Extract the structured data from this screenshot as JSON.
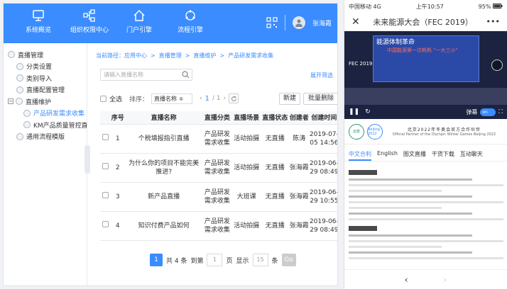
{
  "topnav": {
    "items": [
      {
        "label": "系统概览"
      },
      {
        "label": "组织权限中心"
      },
      {
        "label": "门户引擎"
      },
      {
        "label": "流程引擎"
      }
    ],
    "user": "张海霞"
  },
  "sidebar": {
    "items": [
      {
        "label": "直播管理"
      },
      {
        "label": "分类设置"
      },
      {
        "label": "类别导入"
      },
      {
        "label": "直播配置管理"
      },
      {
        "label": "直播维护"
      },
      {
        "label": "产品研发需求收集"
      },
      {
        "label": "KM产品质量管控直播"
      },
      {
        "label": "通用流程模版"
      }
    ]
  },
  "breadcrumb": {
    "label": "当前路径：",
    "items": [
      "应用中心",
      "直播管理",
      "直播维护",
      "产品研发需求收集"
    ]
  },
  "search": {
    "placeholder": "请输入直播名称",
    "advanced": "展开筛选"
  },
  "toolbar": {
    "select_all": "全选",
    "sort_label": "排序：",
    "sort_value": "直播名称 ≑",
    "page_current": "1",
    "page_total": "/ 1",
    "new_btn": "新建",
    "batch_delete": "批量删除"
  },
  "table": {
    "headers": [
      "序号",
      "直播名称",
      "直播分类",
      "直播场景",
      "直播状态",
      "创建者",
      "创建时间"
    ],
    "rows": [
      {
        "no": "1",
        "name": "个税填报指引直播",
        "category": "产品研发需求收集",
        "scene": "活动拍摄",
        "status": "无直播",
        "creator": "陈涛",
        "time": "2019-07-05 14:56"
      },
      {
        "no": "2",
        "name": "为什么你的项目不能完美推进?",
        "category": "产品研发需求收集",
        "scene": "活动拍摄",
        "status": "无直播",
        "creator": "张海霞",
        "time": "2019-06-29 08:49"
      },
      {
        "no": "3",
        "name": "新产品直播",
        "category": "产品研发需求收集",
        "scene": "大班课",
        "status": "无直播",
        "creator": "张海霞",
        "time": "2019-06-29 10:55"
      },
      {
        "no": "4",
        "name": "知识付费产品如何",
        "category": "产品研发需求收集",
        "scene": "活动拍摄",
        "status": "无直播",
        "creator": "张海霞",
        "time": "2019-06-29 08:49"
      }
    ]
  },
  "pagination": {
    "current": "1",
    "total_text": "共 4 条",
    "goto_label": "到第",
    "goto_value": "1",
    "page_unit": "页",
    "show_label": "显示",
    "page_size": "15",
    "size_unit": "条",
    "go": "Go"
  },
  "phone": {
    "carrier": "中国移动",
    "network": "4G",
    "time": "上午10:57",
    "battery": "95%",
    "title": "未来能源大会（FEC 2019）",
    "video_banner": "能源体制革命",
    "video_banner_sub": "中国能源第一次耗耗 \"一大三小\"",
    "video_fec": "FEC 2019",
    "danmaku_label": "弹幕",
    "danmaku_toggle": "on",
    "sponsor_cn": "北京2022年冬奥会官方合作伙伴",
    "sponsor_en": "Official Partner of the Olympic Winter Games Beijing 2022",
    "sponsor_logo_left": "远景",
    "sponsor_logo_right": "Beijing 2022",
    "tabs": [
      "中文合利",
      "English",
      "图文直播",
      "干货下载",
      "互动聊天"
    ],
    "back": "‹",
    "forward": "›"
  },
  "colors": {
    "primary": "#3b8cff"
  }
}
